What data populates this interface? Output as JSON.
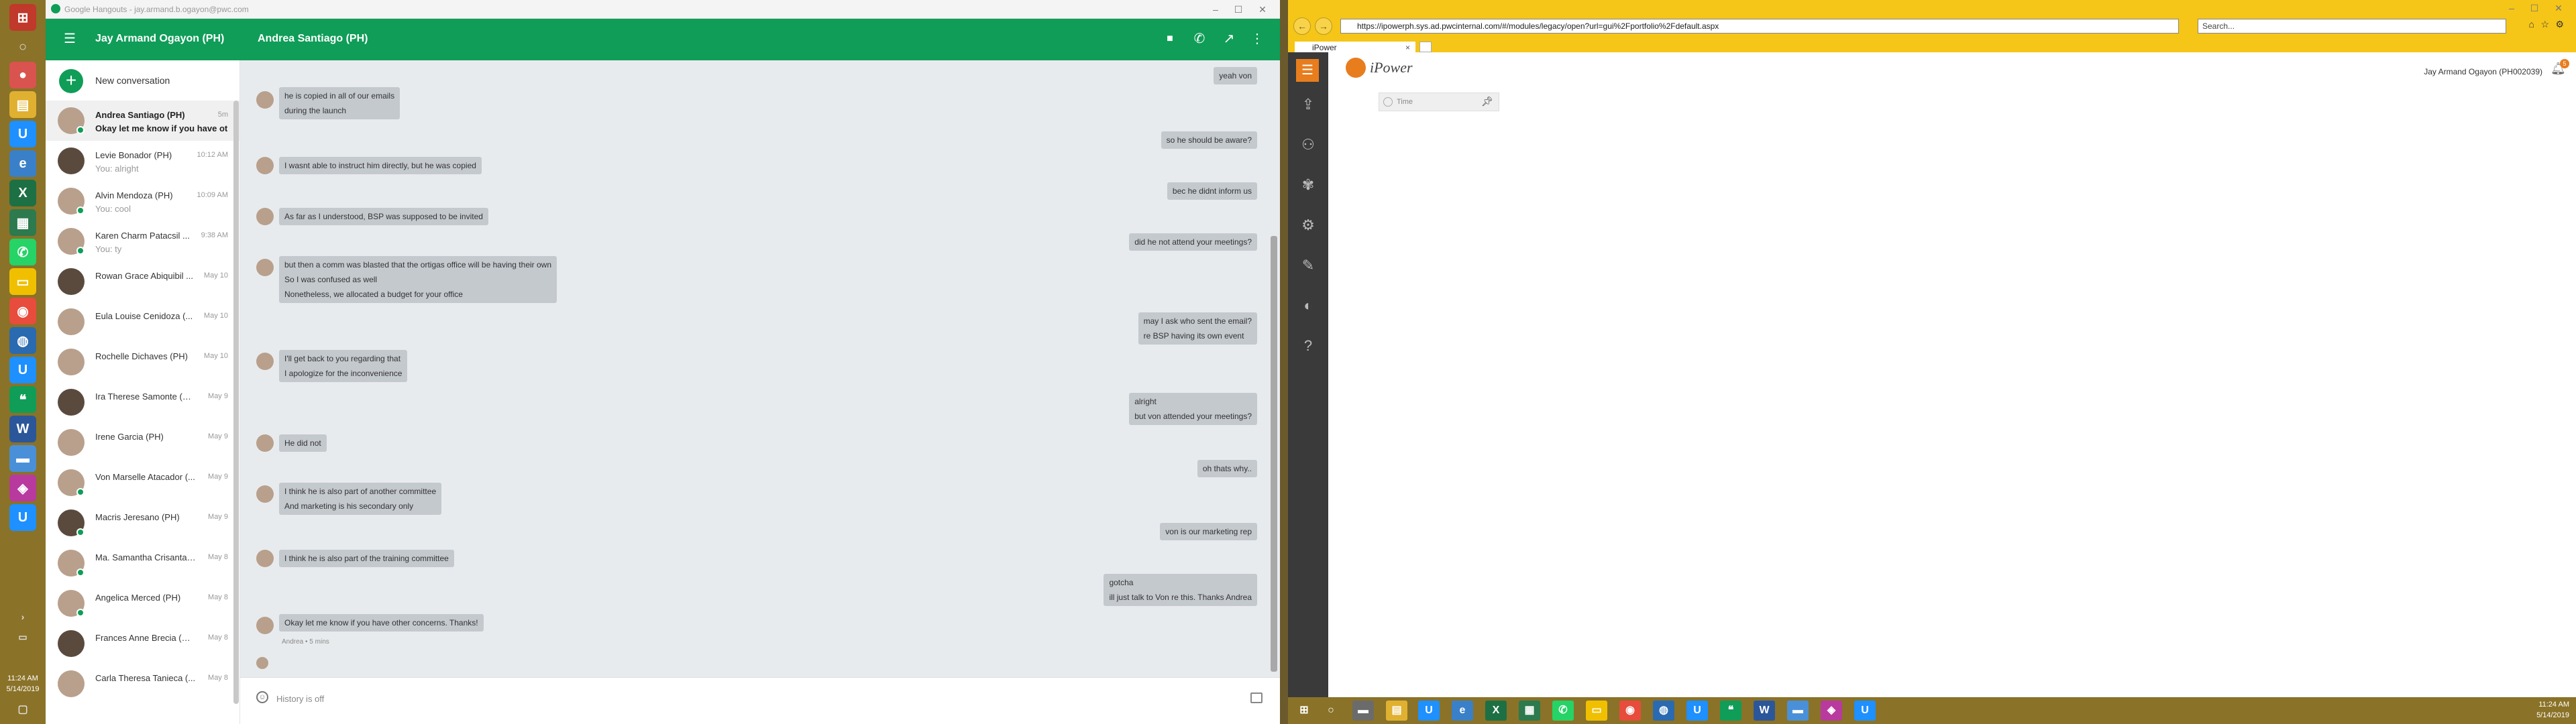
{
  "left_taskbar": {
    "clock_time": "11:24 AM",
    "clock_date": "5/14/2019"
  },
  "hangouts": {
    "window_title": "Google Hangouts - jay.armand.b.ogayon@pwc.com",
    "account_name": "Jay Armand Ogayon (PH)",
    "chat_title": "Andrea Santiago (PH)",
    "new_conversation_label": "New conversation",
    "history_label": "History is off",
    "conversations": [
      {
        "name": "Andrea Santiago (PH)",
        "time": "5m",
        "preview": "Okay let me know if you have ot",
        "active": true,
        "online": true
      },
      {
        "name": "Levie Bonador (PH)",
        "time": "10:12 AM",
        "preview": "You: alright",
        "online": false
      },
      {
        "name": "Alvin Mendoza (PH)",
        "time": "10:09 AM",
        "preview": "You: cool",
        "online": true
      },
      {
        "name": "Karen Charm Patacsil ...",
        "time": "9:38 AM",
        "preview": "You: ty",
        "online": true
      },
      {
        "name": "Rowan Grace Abiquibil ...",
        "time": "May 10",
        "preview": "",
        "online": false
      },
      {
        "name": "Eula Louise Cenidoza (...",
        "time": "May 10",
        "preview": "",
        "online": false
      },
      {
        "name": "Rochelle Dichaves (PH)",
        "time": "May 10",
        "preview": "",
        "online": false
      },
      {
        "name": "Ira Therese Samonte (PH)",
        "time": "May 9",
        "preview": "",
        "online": false
      },
      {
        "name": "Irene Garcia (PH)",
        "time": "May 9",
        "preview": "",
        "online": false
      },
      {
        "name": "Von Marselle Atacador (...",
        "time": "May 9",
        "preview": "",
        "online": true
      },
      {
        "name": "Macris Jeresano (PH)",
        "time": "May 9",
        "preview": "",
        "online": true
      },
      {
        "name": "Ma. Samantha Crisanta ...",
        "time": "May 8",
        "preview": "",
        "online": true
      },
      {
        "name": "Angelica Merced (PH)",
        "time": "May 8",
        "preview": "",
        "online": true
      },
      {
        "name": "Frances Anne Brecia (PH)",
        "time": "May 8",
        "preview": "",
        "online": false
      },
      {
        "name": "Carla Theresa Tanieca (...",
        "time": "May 8",
        "preview": "",
        "online": false
      }
    ],
    "messages": {
      "m01": "yeah von",
      "m02a": "he is copied in all of our emails",
      "m02b": "during the launch",
      "m03": "so he should be aware?",
      "m04": "I wasnt able to instruct him directly, but he was copied",
      "m05": "bec he didnt inform us",
      "m06": "As far as I understood, BSP was supposed to be invited",
      "m07": "did he not attend your meetings?",
      "m08a": "but then a comm was blasted that the ortigas office will be having their own",
      "m08b": "So I was confused as well",
      "m08c": "Nonetheless, we allocated a budget for your office",
      "m09a": "may I ask who sent the email?",
      "m09b": "re BSP having its own event",
      "m10a": "I'll get back to you regarding that",
      "m10b": "I apologize for the inconvenience",
      "m11a": "alright",
      "m11b": "but von attended your meetings?",
      "m12": "He did not",
      "m13": "oh thats why..",
      "m14a": "I think he is also part of another committee",
      "m14b": "And marketing is his secondary only",
      "m15": "von is our marketing rep",
      "m16": "I think he is also part of the training committee",
      "m17a": "gotcha",
      "m17b": "ill just talk to Von re this. Thanks Andrea",
      "m18": "Okay let me know if you have other concerns. Thanks!",
      "m18_meta": "Andrea • 5 mins"
    }
  },
  "browser": {
    "url": "https://ipowerph.sys.ad.pwcinternal.com/#/modules/legacy/open?url=gui%2Fportfolio%2Fdefault.aspx",
    "search_placeholder": "Search...",
    "tab_title": "iPower",
    "app_name": "iPower",
    "user_label": "Jay Armand Ogayon (PH002039)",
    "notification_count": "5",
    "filter_label": "Time"
  },
  "bottom_taskbar": {
    "clock_time": "11:24 AM",
    "clock_date": "5/14/2019"
  },
  "colors": {
    "hangouts_green": "#0f9d58",
    "taskbar": "#8a7228",
    "ie_chrome": "#f5c518",
    "ipower_orange": "#e87d1e"
  }
}
